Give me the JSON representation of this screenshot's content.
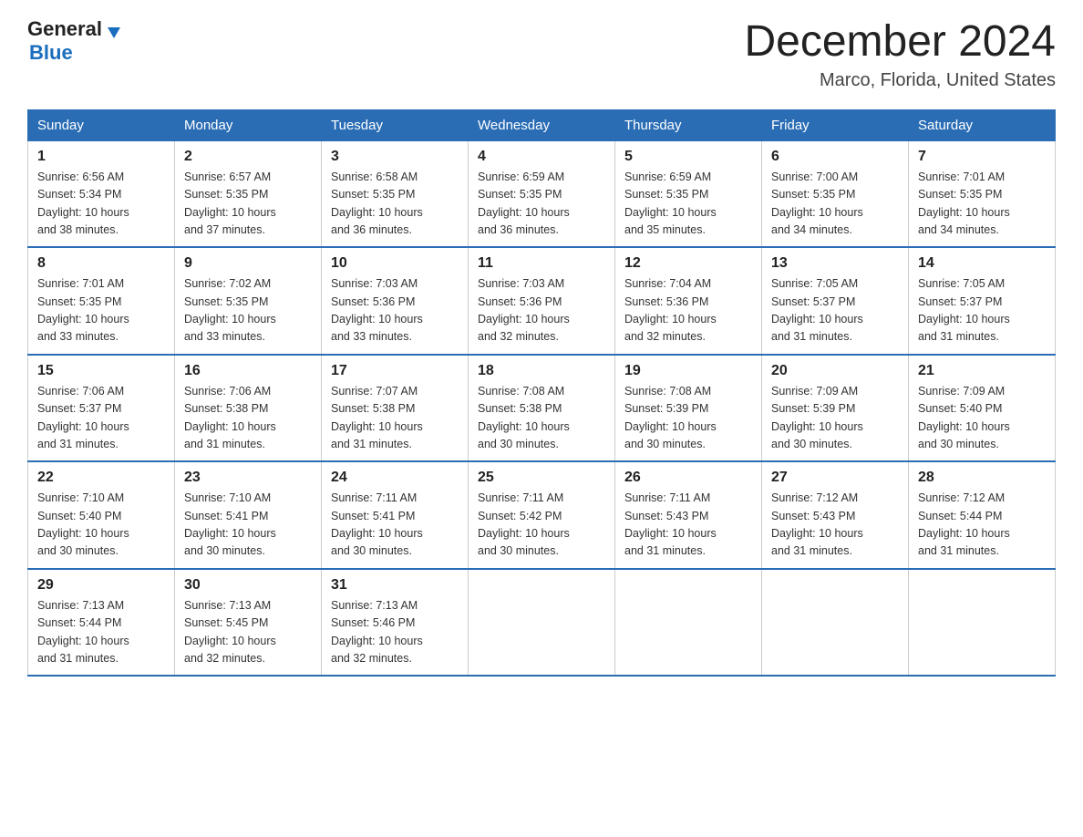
{
  "logo": {
    "general": "General",
    "blue": "Blue",
    "tagline": ""
  },
  "title": "December 2024",
  "location": "Marco, Florida, United States",
  "days_of_week": [
    "Sunday",
    "Monday",
    "Tuesday",
    "Wednesday",
    "Thursday",
    "Friday",
    "Saturday"
  ],
  "weeks": [
    [
      {
        "num": "1",
        "sunrise": "6:56 AM",
        "sunset": "5:34 PM",
        "daylight": "10 hours and 38 minutes."
      },
      {
        "num": "2",
        "sunrise": "6:57 AM",
        "sunset": "5:35 PM",
        "daylight": "10 hours and 37 minutes."
      },
      {
        "num": "3",
        "sunrise": "6:58 AM",
        "sunset": "5:35 PM",
        "daylight": "10 hours and 36 minutes."
      },
      {
        "num": "4",
        "sunrise": "6:59 AM",
        "sunset": "5:35 PM",
        "daylight": "10 hours and 36 minutes."
      },
      {
        "num": "5",
        "sunrise": "6:59 AM",
        "sunset": "5:35 PM",
        "daylight": "10 hours and 35 minutes."
      },
      {
        "num": "6",
        "sunrise": "7:00 AM",
        "sunset": "5:35 PM",
        "daylight": "10 hours and 34 minutes."
      },
      {
        "num": "7",
        "sunrise": "7:01 AM",
        "sunset": "5:35 PM",
        "daylight": "10 hours and 34 minutes."
      }
    ],
    [
      {
        "num": "8",
        "sunrise": "7:01 AM",
        "sunset": "5:35 PM",
        "daylight": "10 hours and 33 minutes."
      },
      {
        "num": "9",
        "sunrise": "7:02 AM",
        "sunset": "5:35 PM",
        "daylight": "10 hours and 33 minutes."
      },
      {
        "num": "10",
        "sunrise": "7:03 AM",
        "sunset": "5:36 PM",
        "daylight": "10 hours and 33 minutes."
      },
      {
        "num": "11",
        "sunrise": "7:03 AM",
        "sunset": "5:36 PM",
        "daylight": "10 hours and 32 minutes."
      },
      {
        "num": "12",
        "sunrise": "7:04 AM",
        "sunset": "5:36 PM",
        "daylight": "10 hours and 32 minutes."
      },
      {
        "num": "13",
        "sunrise": "7:05 AM",
        "sunset": "5:37 PM",
        "daylight": "10 hours and 31 minutes."
      },
      {
        "num": "14",
        "sunrise": "7:05 AM",
        "sunset": "5:37 PM",
        "daylight": "10 hours and 31 minutes."
      }
    ],
    [
      {
        "num": "15",
        "sunrise": "7:06 AM",
        "sunset": "5:37 PM",
        "daylight": "10 hours and 31 minutes."
      },
      {
        "num": "16",
        "sunrise": "7:06 AM",
        "sunset": "5:38 PM",
        "daylight": "10 hours and 31 minutes."
      },
      {
        "num": "17",
        "sunrise": "7:07 AM",
        "sunset": "5:38 PM",
        "daylight": "10 hours and 31 minutes."
      },
      {
        "num": "18",
        "sunrise": "7:08 AM",
        "sunset": "5:38 PM",
        "daylight": "10 hours and 30 minutes."
      },
      {
        "num": "19",
        "sunrise": "7:08 AM",
        "sunset": "5:39 PM",
        "daylight": "10 hours and 30 minutes."
      },
      {
        "num": "20",
        "sunrise": "7:09 AM",
        "sunset": "5:39 PM",
        "daylight": "10 hours and 30 minutes."
      },
      {
        "num": "21",
        "sunrise": "7:09 AM",
        "sunset": "5:40 PM",
        "daylight": "10 hours and 30 minutes."
      }
    ],
    [
      {
        "num": "22",
        "sunrise": "7:10 AM",
        "sunset": "5:40 PM",
        "daylight": "10 hours and 30 minutes."
      },
      {
        "num": "23",
        "sunrise": "7:10 AM",
        "sunset": "5:41 PM",
        "daylight": "10 hours and 30 minutes."
      },
      {
        "num": "24",
        "sunrise": "7:11 AM",
        "sunset": "5:41 PM",
        "daylight": "10 hours and 30 minutes."
      },
      {
        "num": "25",
        "sunrise": "7:11 AM",
        "sunset": "5:42 PM",
        "daylight": "10 hours and 30 minutes."
      },
      {
        "num": "26",
        "sunrise": "7:11 AM",
        "sunset": "5:43 PM",
        "daylight": "10 hours and 31 minutes."
      },
      {
        "num": "27",
        "sunrise": "7:12 AM",
        "sunset": "5:43 PM",
        "daylight": "10 hours and 31 minutes."
      },
      {
        "num": "28",
        "sunrise": "7:12 AM",
        "sunset": "5:44 PM",
        "daylight": "10 hours and 31 minutes."
      }
    ],
    [
      {
        "num": "29",
        "sunrise": "7:13 AM",
        "sunset": "5:44 PM",
        "daylight": "10 hours and 31 minutes."
      },
      {
        "num": "30",
        "sunrise": "7:13 AM",
        "sunset": "5:45 PM",
        "daylight": "10 hours and 32 minutes."
      },
      {
        "num": "31",
        "sunrise": "7:13 AM",
        "sunset": "5:46 PM",
        "daylight": "10 hours and 32 minutes."
      },
      null,
      null,
      null,
      null
    ]
  ],
  "labels": {
    "sunrise": "Sunrise:",
    "sunset": "Sunset:",
    "daylight": "Daylight:"
  }
}
